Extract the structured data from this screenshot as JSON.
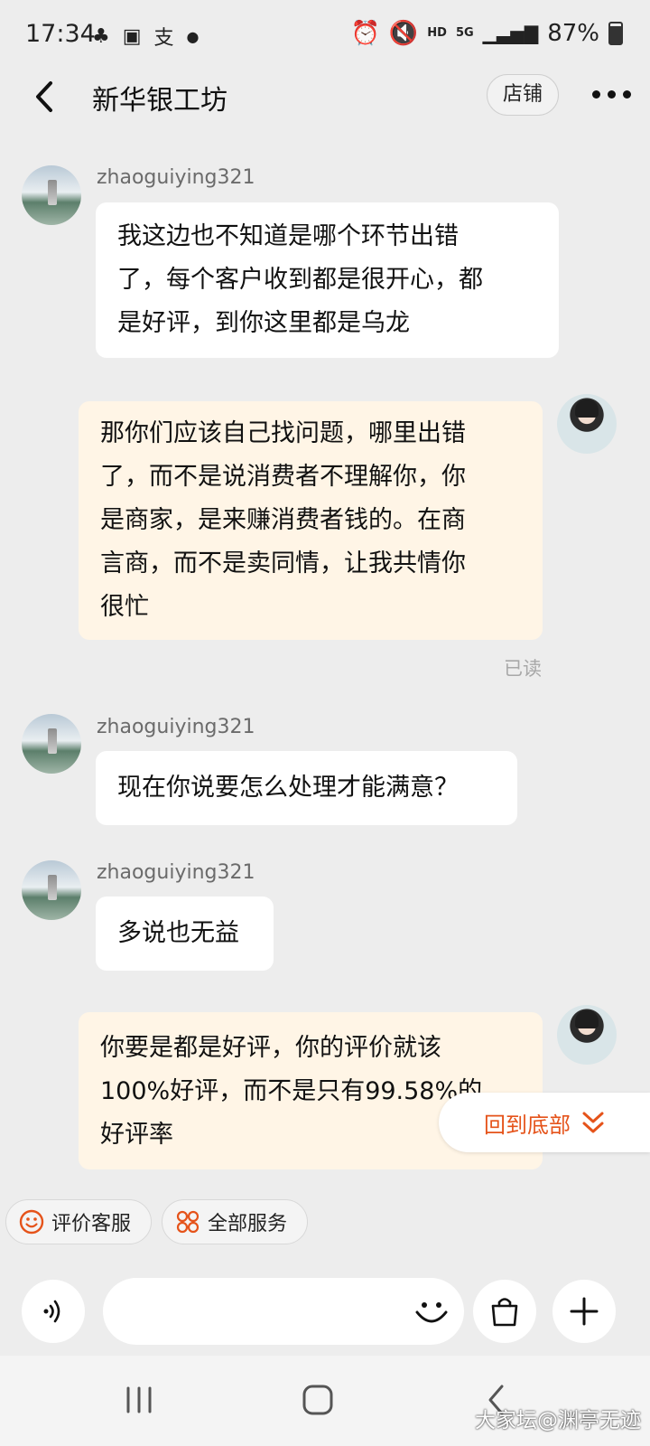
{
  "status_bar": {
    "time": "17:34",
    "battery": "87%",
    "net_hd": "HD",
    "net_5g": "5G"
  },
  "header": {
    "title": "新华银工坊",
    "shop_button": "店铺"
  },
  "messages": [
    {
      "side": "left",
      "username": "zhaoguiying321",
      "lines": [
        "我这边也不知道是哪个环节出错",
        "了，每个客户收到都是很开心，都",
        "是好评，到你这里都是乌龙"
      ]
    },
    {
      "side": "right",
      "lines": [
        "那你们应该自己找问题，哪里出错",
        "了，而不是说消费者不理解你，你",
        "是商家，是来赚消费者钱的。在商",
        "言商，而不是卖同情，让我共情你",
        "很忙"
      ],
      "status": "已读"
    },
    {
      "side": "left",
      "username": "zhaoguiying321",
      "lines": [
        "现在你说要怎么处理才能满意？"
      ]
    },
    {
      "side": "left",
      "username": "zhaoguiying321",
      "lines": [
        "多说也无益"
      ]
    },
    {
      "side": "right",
      "lines": [
        "你要是都是好评，你的评价就该",
        "100%好评，而不是只有99.58%的",
        "好评率"
      ]
    }
  ],
  "back_to_bottom": "回到底部",
  "services": {
    "rate_service": "评价客服",
    "all_services": "全部服务"
  },
  "watermark": "大家坛@渊亭无迹",
  "colors": {
    "accent": "#e5531a",
    "my_bubble": "#fff5e6",
    "their_bubble": "#ffffff",
    "background": "#ededed"
  },
  "icons": {
    "back": "chevron-left-icon",
    "more": "more-dots-icon",
    "voice": "voice-icon",
    "emoji": "smiley-icon",
    "bag": "shopping-bag-icon",
    "plus": "plus-icon"
  }
}
